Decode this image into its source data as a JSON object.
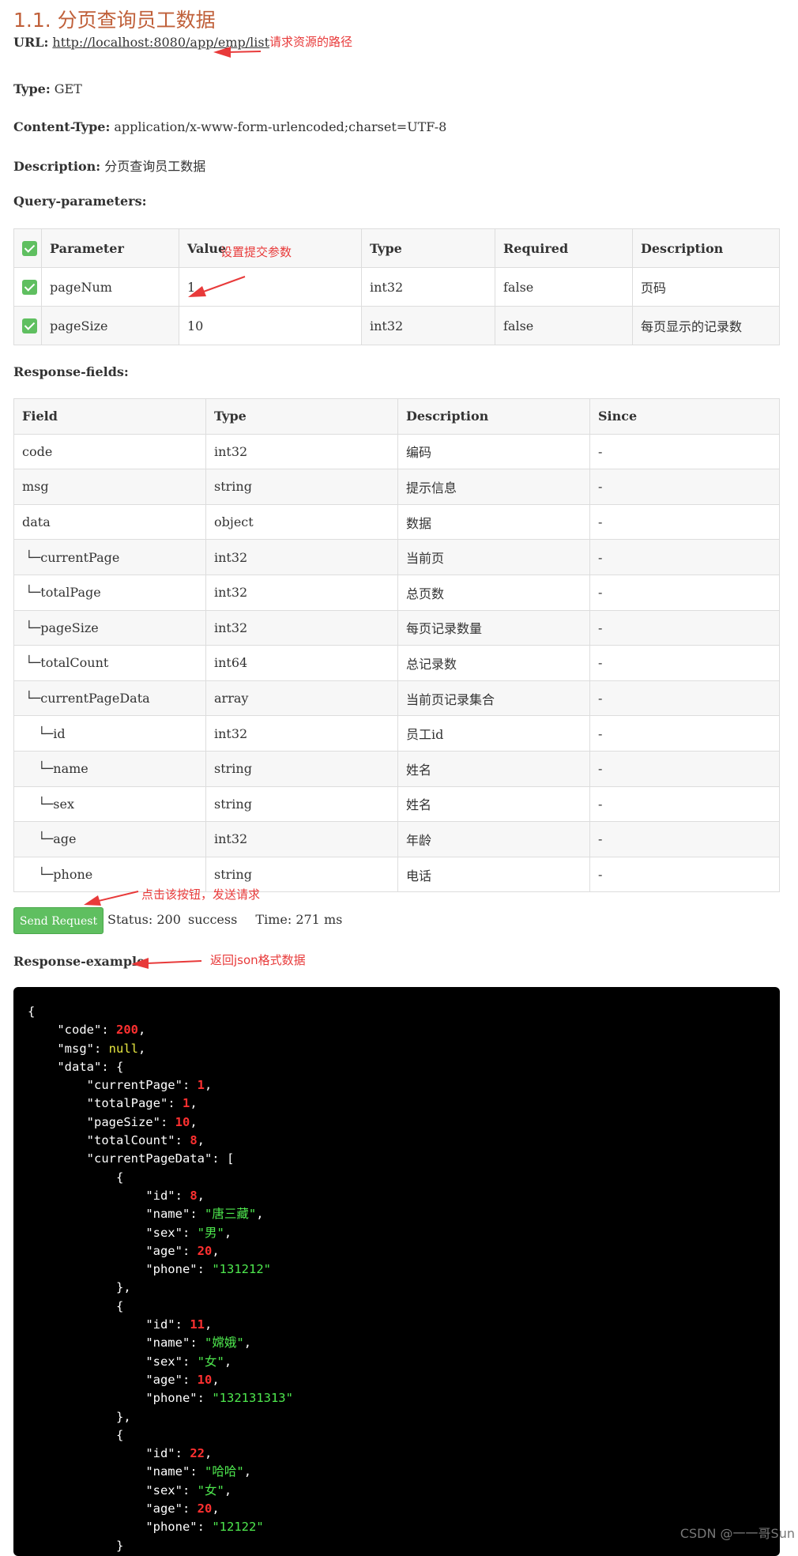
{
  "title": "1.1. 分页查询员工数据",
  "meta": {
    "url_label": "URL:",
    "url_value": "http://localhost:8080/app/emp/list",
    "type_label": "Type:",
    "type_value": "GET",
    "content_type_label": "Content-Type:",
    "content_type_value": "application/x-www-form-urlencoded;charset=UTF-8",
    "description_label": "Description:",
    "description_value": "分页查询员工数据"
  },
  "query_parameters": {
    "label": "Query-parameters:",
    "headers": [
      "Parameter",
      "Value",
      "Type",
      "Required",
      "Description"
    ],
    "rows": [
      {
        "parameter": "pageNum",
        "value": "1",
        "type": "int32",
        "required": "false",
        "description": "页码"
      },
      {
        "parameter": "pageSize",
        "value": "10",
        "type": "int32",
        "required": "false",
        "description": "每页显示的记录数"
      }
    ]
  },
  "response_fields": {
    "label": "Response-fields:",
    "headers": [
      "Field",
      "Type",
      "Description",
      "Since"
    ],
    "rows": [
      {
        "field": "code",
        "type": "int32",
        "description": "编码",
        "since": "-"
      },
      {
        "field": "msg",
        "type": "string",
        "description": "提示信息",
        "since": "-"
      },
      {
        "field": "data",
        "type": "object",
        "description": "数据",
        "since": "-"
      },
      {
        "field": "└─currentPage",
        "type": "int32",
        "description": "当前页",
        "since": "-"
      },
      {
        "field": "└─totalPage",
        "type": "int32",
        "description": "总页数",
        "since": "-"
      },
      {
        "field": "└─pageSize",
        "type": "int32",
        "description": "每页记录数量",
        "since": "-"
      },
      {
        "field": "└─totalCount",
        "type": "int64",
        "description": "总记录数",
        "since": "-"
      },
      {
        "field": "└─currentPageData",
        "type": "array",
        "description": "当前页记录集合",
        "since": "-"
      },
      {
        "field": "└─id",
        "type": "int32",
        "description": "员工id",
        "since": "-"
      },
      {
        "field": "└─name",
        "type": "string",
        "description": "姓名",
        "since": "-"
      },
      {
        "field": "└─sex",
        "type": "string",
        "description": "姓名",
        "since": "-"
      },
      {
        "field": "└─age",
        "type": "int32",
        "description": "年龄",
        "since": "-"
      },
      {
        "field": "└─phone",
        "type": "string",
        "description": "电话",
        "since": "-"
      }
    ]
  },
  "send": {
    "button_label": "Send Request",
    "status_text": "Status: 200",
    "status_word": "success",
    "time_text": "Time: 271 ms"
  },
  "response_example": {
    "label": "Response-example:",
    "top": {
      "code": 200,
      "msg": "null",
      "currentPage": 1,
      "totalPage": 1,
      "pageSize": 10,
      "totalCount": 8
    },
    "records": [
      {
        "id": 8,
        "name": "唐三藏",
        "sex": "男",
        "age": 20,
        "phone": "131212"
      },
      {
        "id": 11,
        "name": "嫦娥",
        "sex": "女",
        "age": 10,
        "phone": "132131313"
      },
      {
        "id": 22,
        "name": "哈哈",
        "sex": "女",
        "age": 20,
        "phone": "12122"
      }
    ]
  },
  "annotations": {
    "url_note": "请求资源的路径",
    "param_note": "设置提交参数",
    "send_note": "点击该按钮，发送请求",
    "response_note": "返回json格式数据"
  },
  "watermark": "CSDN @一一哥Sun",
  "colors": {
    "title": "#c0603a",
    "accent_green": "#5fbf60",
    "annotation_red": "#e83a3a",
    "json_number": "#ff3030",
    "json_string": "#4ee84e",
    "json_null": "#e8e840"
  }
}
